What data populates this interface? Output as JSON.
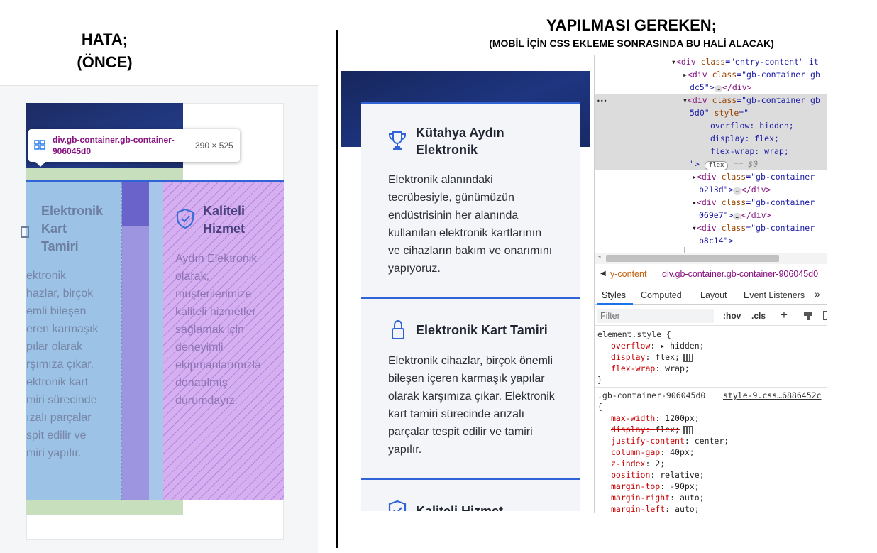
{
  "headings": {
    "left_title": "HATA;",
    "left_subtitle": "(ÖNCE)",
    "right_title": "YAPILMASI GEREKEN;",
    "right_subtitle": "(MOBİL İÇİN CSS EKLEME SONRASINDA BU HALİ ALACAK)"
  },
  "left_panel": {
    "tooltip_selector": "div.gb-container.gb-container-906045d0",
    "tooltip_size": "390 × 525",
    "col1_title": [
      "Elektronik",
      "Kart",
      "Tamiri"
    ],
    "col1_text": [
      "ektronik",
      "hazlar, birçok",
      "emli bileşen",
      "eren karmaşık",
      "pılar olarak",
      "rşımıza çıkar.",
      "ektronik kart",
      "miri sürecinde",
      "ızalı parçalar",
      "spit edilir ve",
      "miri yapılır."
    ],
    "col2_title": [
      "Kaliteli",
      "Hizmet"
    ],
    "col2_text": [
      "Aydın Elektronik",
      "olarak,",
      "müşterilerimize",
      "kaliteli hizmetler",
      "sağlamak için",
      "deneyimli",
      "ekipmanlarımızla",
      "donatılmış",
      "durumdayız."
    ]
  },
  "middle_panel": {
    "cards": [
      {
        "icon": "trophy-icon",
        "title": [
          "Kütahya Aydın",
          "Elektronik"
        ],
        "text": [
          "Elektronik alanındaki",
          "tecrübesiyle, günümüzün",
          "endüstrisinin her alanında",
          "kullanılan elektronik kartlarının",
          "ve cihazların bakım ve onarımını",
          "yapıyoruz."
        ]
      },
      {
        "icon": "lock-icon",
        "title": [
          "Elektronik Kart Tamiri"
        ],
        "text": [
          "Elektronik cihazlar, birçok önemli",
          "bileşen içeren karmaşık yapılar",
          "olarak karşımıza çıkar. Elektronik",
          "kart tamiri sürecinde arızalı",
          "parçalar tespit edilir ve tamiri",
          "yapılır."
        ]
      },
      {
        "icon": "shield-check-icon",
        "title": [
          "Kaliteli Hizmet"
        ],
        "text": []
      }
    ]
  },
  "devtools": {
    "dom": {
      "l1": [
        "<div ",
        "class",
        "=\"entry-content\" it"
      ],
      "l2": [
        "<div ",
        "class",
        "=\"gb-container gb"
      ],
      "l3": [
        "dc5\">",
        "</div>"
      ],
      "l4": [
        "<div ",
        "class",
        "=\"gb-container gb"
      ],
      "l5": [
        "5d0\" ",
        "style",
        "=\""
      ],
      "l6": "overflow: hidden;",
      "l7": "display: flex;",
      "l8": "flex-wrap: wrap;",
      "l9a": "\">",
      "l9b": "flex",
      "l9c": "== $0",
      "l10": [
        "<div ",
        "class",
        "=\"gb-container"
      ],
      "l11": [
        "b213d\">",
        "</div>"
      ],
      "l12": [
        "<div ",
        "class",
        "=\"gb-container"
      ],
      "l13": [
        "069e7\">",
        "</div>"
      ],
      "l14": [
        "<div ",
        "class",
        "=\"gb-container"
      ],
      "l15": "b8c14\">",
      "ellipsis": "•••"
    },
    "breadcrumb": [
      "y-content",
      "div.gb-container.gb-container-906045d0"
    ],
    "tabs": [
      "Styles",
      "Computed",
      "Layout",
      "Event Listeners",
      "»"
    ],
    "filter_placeholder": "Filter",
    "hov": ":hov",
    "cls": ".cls",
    "element_style": {
      "selector": "element.style {",
      "rules": [
        {
          "prop": "overflow",
          "value": "▸ hidden;"
        },
        {
          "prop": "display",
          "value": "flex;"
        },
        {
          "prop": "flex-wrap",
          "value": "wrap;"
        }
      ],
      "close": "}"
    },
    "class_rule": {
      "selector": ".gb-container-906045d0",
      "source": "style-9.css…6886452c",
      "open": "{",
      "rules": [
        {
          "prop": "max-width",
          "value": "1200px;"
        },
        {
          "prop": "display",
          "value": "flex;",
          "struck": true
        },
        {
          "prop": "justify-content",
          "value": "center;"
        },
        {
          "prop": "column-gap",
          "value": "40px;"
        },
        {
          "prop": "z-index",
          "value": "2;"
        },
        {
          "prop": "position",
          "value": "relative;"
        },
        {
          "prop": "margin-top",
          "value": "-90px;"
        },
        {
          "prop": "margin-right",
          "value": "auto;"
        },
        {
          "prop": "margin-left",
          "value": "auto;"
        }
      ]
    }
  },
  "colors": {
    "accent_blue": "#2f63d6",
    "hero_navy": "#1e3580",
    "overlay_blue": "#9cc2e6",
    "overlay_purple": "#d5b0f0",
    "overlay_green": "#c7dfbd"
  }
}
